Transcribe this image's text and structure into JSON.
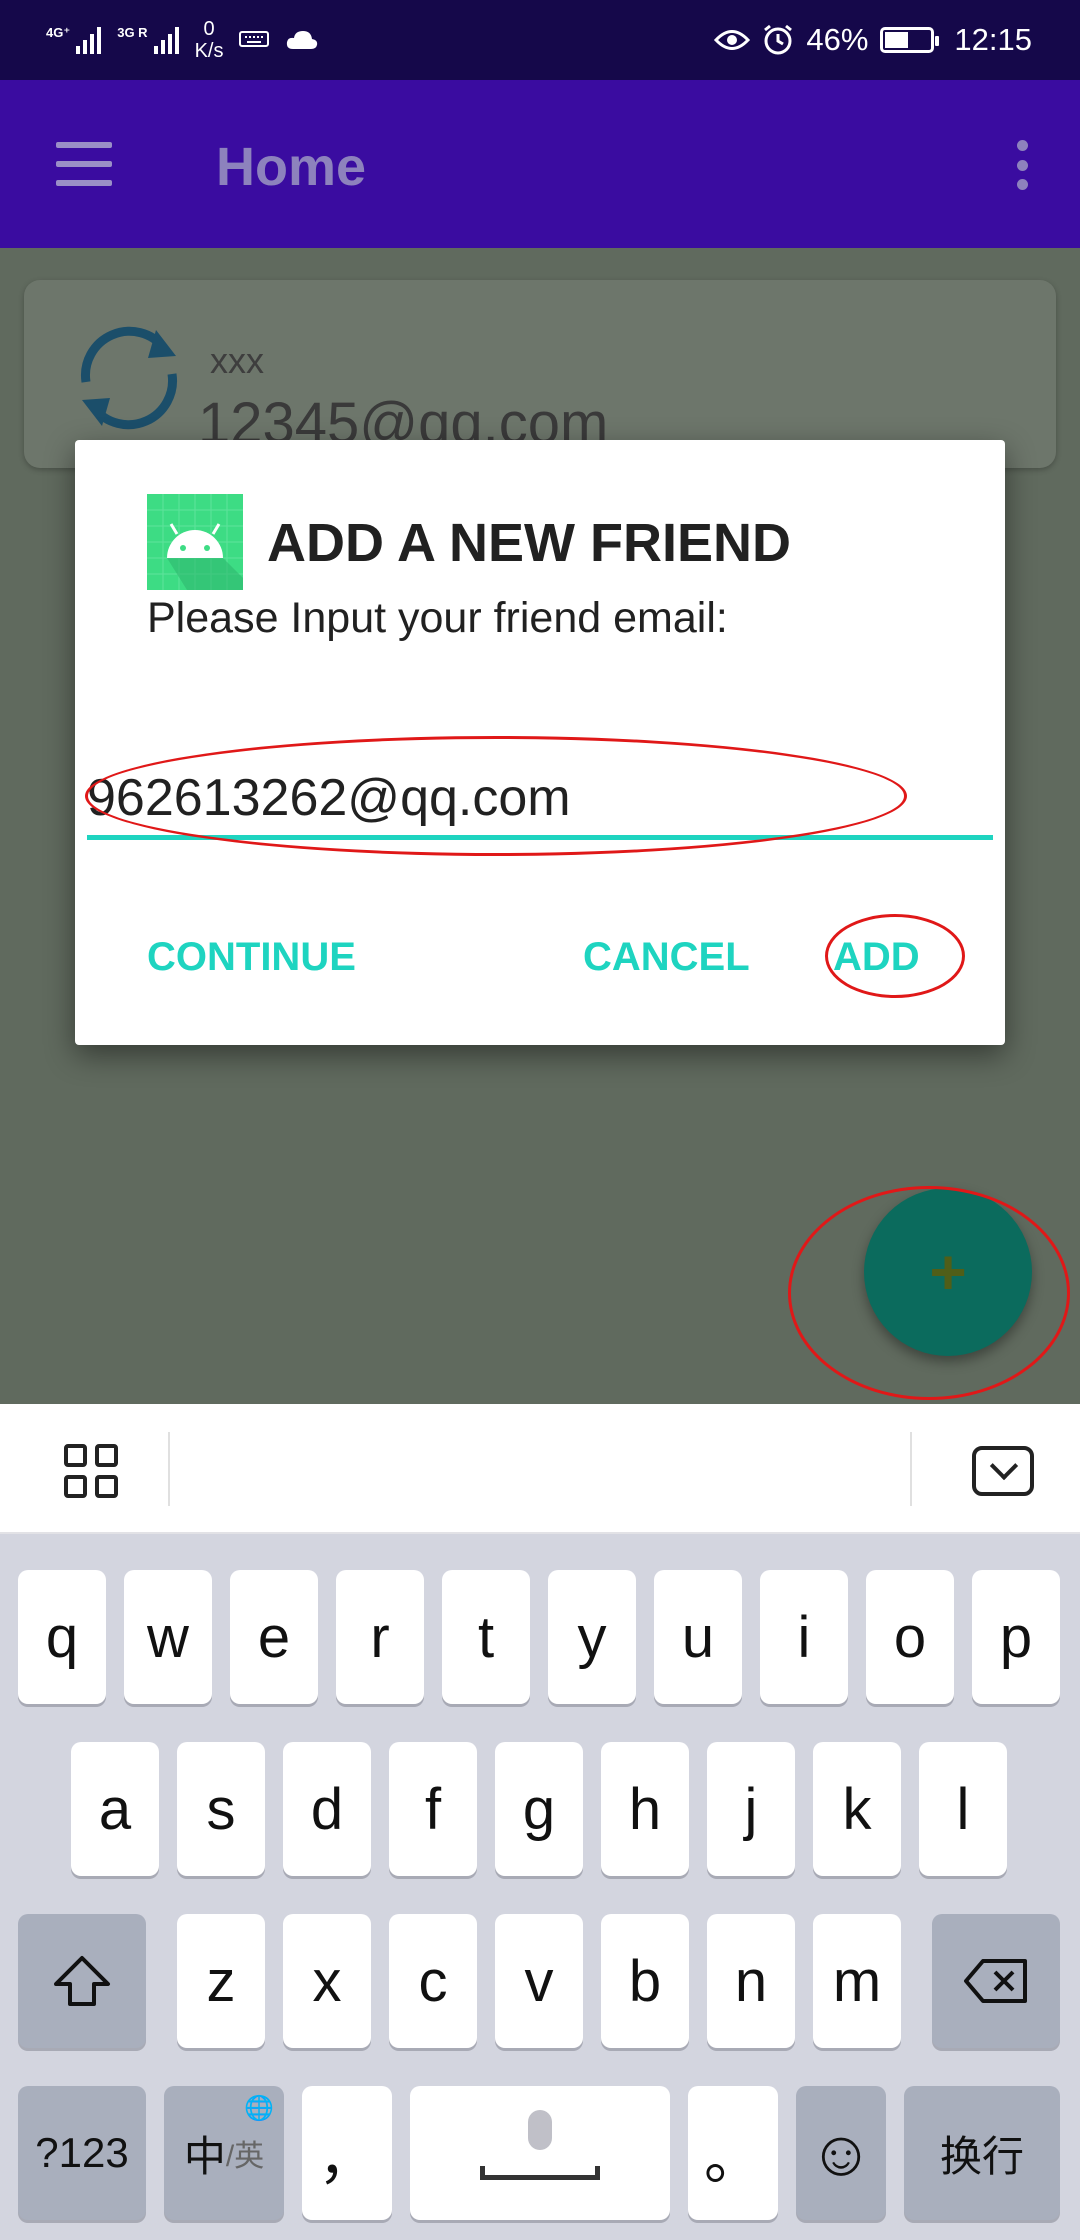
{
  "status_bar": {
    "signal1_label": "4G⁺",
    "signal2_label": "3G R",
    "net_speed_value": "0",
    "net_speed_unit": "K/s",
    "battery": "46%",
    "battery_level": 0.46,
    "time": "12:15",
    "icons": [
      "keyboard-icon",
      "cloud-icon",
      "eye-icon",
      "alarm-icon",
      "battery-icon"
    ]
  },
  "app_bar": {
    "title": "Home",
    "icons": [
      "menu-icon",
      "overflow-menu-icon"
    ]
  },
  "friend_card": {
    "name": "xxx",
    "email": "12345@qq.com",
    "icon": "sync-icon"
  },
  "dialog": {
    "title": "ADD A NEW FRIEND",
    "message": "Please Input your friend email:",
    "input_value": "962613262@qq.com",
    "buttons": {
      "continue": "CONTINUE",
      "cancel": "CANCEL",
      "add": "ADD"
    },
    "accent_color": "#1ed4c0",
    "icon": "android-app-icon"
  },
  "fab": {
    "label": "+",
    "color": "#0b6b5d"
  },
  "annotation_color": "#e01818",
  "keyboard": {
    "row1": [
      "q",
      "w",
      "e",
      "r",
      "t",
      "y",
      "u",
      "i",
      "o",
      "p"
    ],
    "row2": [
      "a",
      "s",
      "d",
      "f",
      "g",
      "h",
      "j",
      "k",
      "l"
    ],
    "row3": [
      "z",
      "x",
      "c",
      "v",
      "b",
      "n",
      "m"
    ],
    "numbers_key": "?123",
    "lang_key_main": "中",
    "lang_key_sub": "/英",
    "comma_key": "，",
    "period_key": "。",
    "enter_key": "换行",
    "emoji_key": "☺",
    "icons": [
      "keyboard-grid-icon",
      "keyboard-hide-icon",
      "shift-icon",
      "backspace-icon",
      "globe-icon",
      "mic-icon"
    ]
  }
}
